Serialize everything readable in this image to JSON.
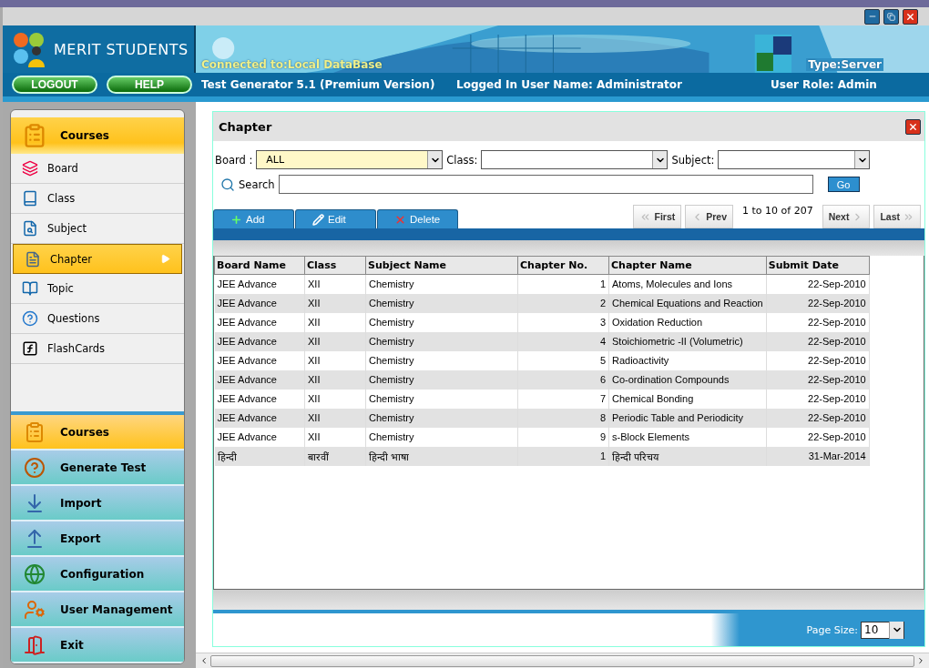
{
  "header": {
    "brand": "MERIT STUDENTS",
    "connection": "Connected to:Local DataBase",
    "type": "Type:Server"
  },
  "toolbar": {
    "buttons": [
      "LOGOUT",
      "HELP"
    ],
    "app_name": "Test Generator 5.1 (Premium Version)",
    "user": "Logged In User Name:  Administrator",
    "role": "User Role: Admin"
  },
  "sidebar": {
    "section_title": "Courses",
    "items": [
      {
        "label": "Board",
        "selected": false
      },
      {
        "label": "Class",
        "selected": false
      },
      {
        "label": "Subject",
        "selected": false
      },
      {
        "label": "Chapter",
        "selected": true
      },
      {
        "label": "Topic",
        "selected": false
      },
      {
        "label": "Questions",
        "selected": false
      },
      {
        "label": "FlashCards",
        "selected": false
      }
    ],
    "categories": [
      {
        "label": "Courses",
        "selected": true
      },
      {
        "label": "Generate Test",
        "selected": false
      },
      {
        "label": "Import",
        "selected": false
      },
      {
        "label": "Export",
        "selected": false
      },
      {
        "label": "Configuration",
        "selected": false
      },
      {
        "label": "User Management",
        "selected": false
      },
      {
        "label": "Exit",
        "selected": false
      }
    ]
  },
  "panel": {
    "title": "Chapter",
    "filters": [
      {
        "label": "Board :",
        "value": "ALL",
        "focused": true
      },
      {
        "label": "Class:",
        "focused": false
      },
      {
        "label": "Subject:",
        "focused": false
      }
    ],
    "search": {
      "label": "Search",
      "button": "Go"
    },
    "actions": [
      "Add",
      "Edit",
      "Delete"
    ],
    "pager": {
      "first": "First",
      "prev": "Prev",
      "range": "1 to 10 of 207",
      "next": "Next",
      "last": "Last"
    },
    "table": {
      "columns": [
        "Board Name",
        "Class",
        "Subject Name",
        "Chapter No.",
        "Chapter Name",
        "Submit Date"
      ],
      "rows": [
        [
          "JEE Advance",
          "XII",
          "Chemistry",
          "1",
          "Atoms, Molecules and Ions",
          "22-Sep-2010"
        ],
        [
          "JEE Advance",
          "XII",
          "Chemistry",
          "2",
          "Chemical Equations and Reaction",
          "22-Sep-2010"
        ],
        [
          "JEE Advance",
          "XII",
          "Chemistry",
          "3",
          "Oxidation Reduction",
          "22-Sep-2010"
        ],
        [
          "JEE Advance",
          "XII",
          "Chemistry",
          "4",
          "Stoichiometric -II (Volumetric)",
          "22-Sep-2010"
        ],
        [
          "JEE Advance",
          "XII",
          "Chemistry",
          "5",
          "Radioactivity",
          "22-Sep-2010"
        ],
        [
          "JEE Advance",
          "XII",
          "Chemistry",
          "6",
          "Co-ordination Compounds",
          "22-Sep-2010"
        ],
        [
          "JEE Advance",
          "XII",
          "Chemistry",
          "7",
          "Chemical Bonding",
          "22-Sep-2010"
        ],
        [
          "JEE Advance",
          "XII",
          "Chemistry",
          "8",
          "Periodic Table and Periodicity",
          "22-Sep-2010"
        ],
        [
          "JEE Advance",
          "XII",
          "Chemistry",
          "9",
          "s-Block Elements",
          "22-Sep-2010"
        ],
        [
          "हिन्दी",
          "बारवीं",
          "हिन्दी भाषा",
          "1",
          "हिन्दी परिचय",
          "31-Mar-2014"
        ]
      ]
    },
    "page_size": {
      "label": "Page Size:",
      "value": "10"
    }
  }
}
